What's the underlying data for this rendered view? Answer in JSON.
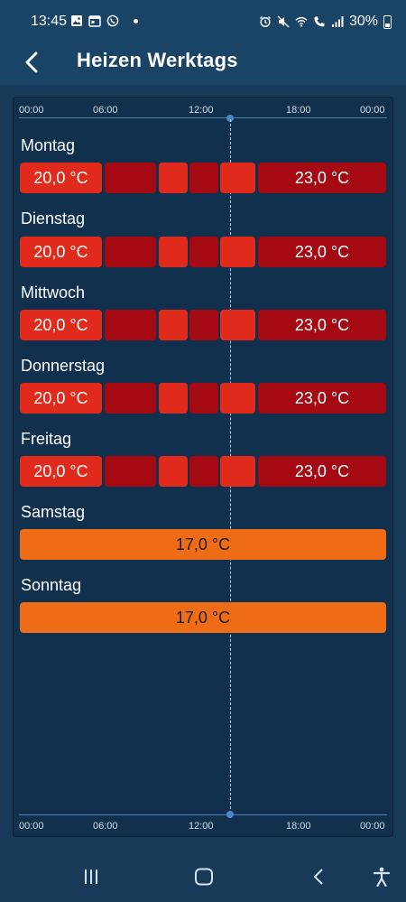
{
  "status_bar": {
    "time": "13:45",
    "battery": "30%"
  },
  "app_bar": {
    "title": "Heizen Werktags"
  },
  "timeline": {
    "ticks": [
      "00:00",
      "06:00",
      "12:00",
      "18:00",
      "00:00"
    ]
  },
  "days": [
    {
      "name": "Montag",
      "start_temp": "20,0 °C",
      "end_temp": "23,0 °C"
    },
    {
      "name": "Dienstag",
      "start_temp": "20,0 °C",
      "end_temp": "23,0 °C"
    },
    {
      "name": "Mittwoch",
      "start_temp": "20,0 °C",
      "end_temp": "23,0 °C"
    },
    {
      "name": "Donnerstag",
      "start_temp": "20,0 °C",
      "end_temp": "23,0 °C"
    },
    {
      "name": "Freitag",
      "start_temp": "20,0 °C",
      "end_temp": "23,0 °C"
    },
    {
      "name": "Samstag",
      "temp": "17,0 °C"
    },
    {
      "name": "Sonntag",
      "temp": "17,0 °C"
    }
  ],
  "colors": {
    "background": "#163a58",
    "panel": "#10304d",
    "segment_bright": "#e02b1c",
    "segment_dark": "#a50a12",
    "segment_weekend": "#ef6c17",
    "axis": "#4d7fb5"
  }
}
